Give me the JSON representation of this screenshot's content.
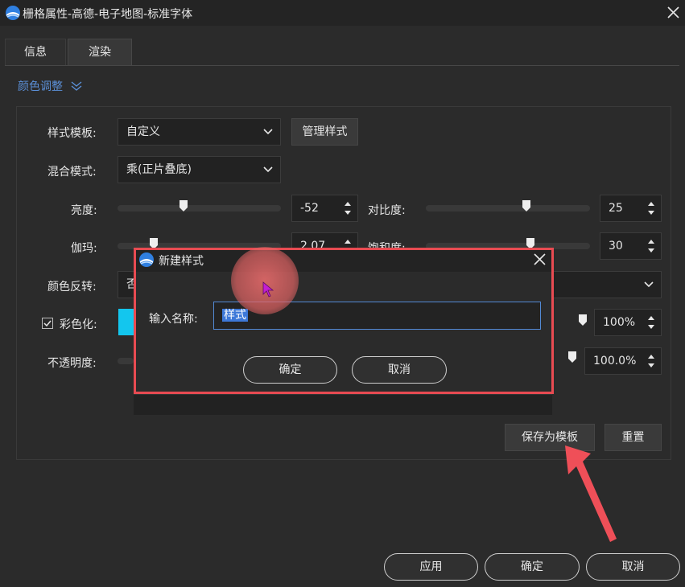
{
  "window": {
    "title": "栅格属性-高德-电子地图-标准字体",
    "icon": "app-logo-icon",
    "close_icon": "close-icon"
  },
  "tabs": [
    {
      "label": "信息",
      "active": false
    },
    {
      "label": "渲染",
      "active": true
    }
  ],
  "section": {
    "label": "颜色调整",
    "icon": "chevron-double-down-icon"
  },
  "form": {
    "template_label": "样式模板:",
    "template_value": "自定义",
    "manage_button": "管理样式",
    "blend_label": "混合模式:",
    "blend_value": "乘(正片叠底)",
    "brightness_label": "亮度:",
    "brightness_value": "-52",
    "brightness_level": -52,
    "contrast_label": "对比度:",
    "contrast_value": "25",
    "contrast_level": 25,
    "gamma_label": "伽玛:",
    "gamma_value": "2.07",
    "saturation_label": "饱和度:",
    "saturation_value": "30",
    "invert_label": "颜色反转:",
    "invert_value": "否",
    "colorize_label": "彩色化:",
    "colorize_checked": true,
    "colorize_color": "#13c6ee",
    "colorize_value": "100%",
    "opacity_label": "不透明度:",
    "opacity_value": "100.0%",
    "save_template_button": "保存为模板",
    "reset_button": "重置"
  },
  "footer": {
    "apply": "应用",
    "ok": "确定",
    "cancel": "取消"
  },
  "dialog": {
    "title": "新建样式",
    "name_label": "输入名称:",
    "name_value": "样式",
    "ok": "确定",
    "cancel": "取消"
  },
  "colors": {
    "accent": "#5b8fd6",
    "highlight_box": "#e84b52",
    "selection": "#3d78d8"
  }
}
